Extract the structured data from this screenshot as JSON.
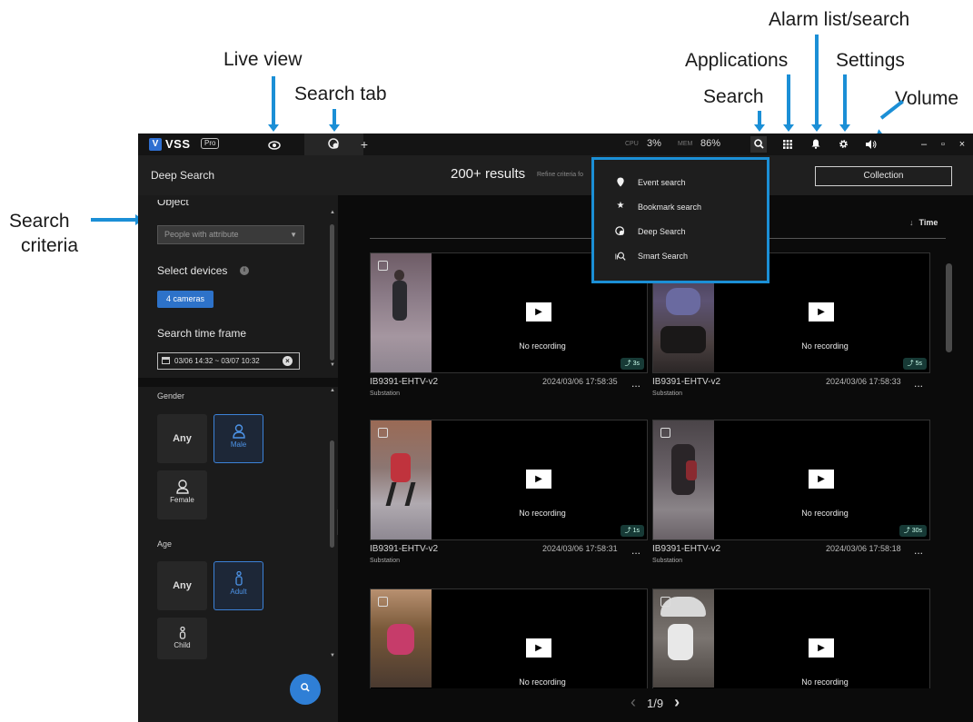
{
  "annotations": {
    "live_view": "Live view",
    "search_tab": "Search tab",
    "applications": "Applications",
    "alarm_list": "Alarm list/search",
    "settings": "Settings",
    "search": "Search",
    "volume": "Volume",
    "search_criteria_1": "Search",
    "search_criteria_2": "criteria"
  },
  "titlebar": {
    "logo_mark": "V",
    "logo_text": "VSS",
    "logo_badge": "Pro",
    "add_tab": "+",
    "cpu_label": "CPU",
    "cpu_value": "3%",
    "mem_label": "MEM",
    "mem_value": "86%",
    "win_min": "–",
    "win_max": "▫",
    "win_close": "×"
  },
  "header": {
    "title": "Deep Search",
    "results": "200+ results",
    "refine": "Refine criteria fo",
    "collection": "Collection"
  },
  "search_menu": {
    "items": [
      {
        "label": "Event search",
        "icon": "pin-icon"
      },
      {
        "label": "Bookmark search",
        "icon": "star-icon"
      },
      {
        "label": "Deep Search",
        "icon": "deep-search-icon"
      },
      {
        "label": "Smart Search",
        "icon": "smart-search-icon"
      }
    ]
  },
  "sidebar": {
    "object_label": "Object",
    "object_value": "People with attribute",
    "devices_label": "Select devices",
    "devices_info": "i",
    "devices_value": "4 cameras",
    "timeframe_label": "Search time frame",
    "timeframe_value": "03/06 14:32 ~ 03/07 10:32",
    "timeframe_clear": "×",
    "gender_label": "Gender",
    "gender_any": "Any",
    "gender_male": "Male",
    "gender_female": "Female",
    "age_label": "Age",
    "age_any": "Any",
    "age_adult": "Adult",
    "age_child": "Child"
  },
  "main": {
    "sort_label": "Time",
    "sort_arrow": "↓",
    "no_recording": "No recording",
    "play": "▶",
    "more": "...",
    "cards": [
      {
        "camera": "IB9391-EHTV-v2",
        "location": "Substation",
        "timestamp": "2024/03/06 17:58:35",
        "duration": "3s"
      },
      {
        "camera": "IB9391-EHTV-v2",
        "location": "Substation",
        "timestamp": "2024/03/06 17:58:33",
        "duration": "5s"
      },
      {
        "camera": "IB9391-EHTV-v2",
        "location": "Substation",
        "timestamp": "2024/03/06 17:58:31",
        "duration": "1s"
      },
      {
        "camera": "IB9391-EHTV-v2",
        "location": "Substation",
        "timestamp": "2024/03/06 17:58:18",
        "duration": "30s"
      },
      {
        "camera": "",
        "location": "",
        "timestamp": "",
        "duration": ""
      },
      {
        "camera": "",
        "location": "",
        "timestamp": "",
        "duration": ""
      }
    ],
    "pager_prev": "‹",
    "pager_text": "1/9",
    "pager_next": "›"
  },
  "colors": {
    "accent": "#1b8fd6",
    "primary_button": "#2d72c9",
    "selected_border": "#3c82d8"
  }
}
